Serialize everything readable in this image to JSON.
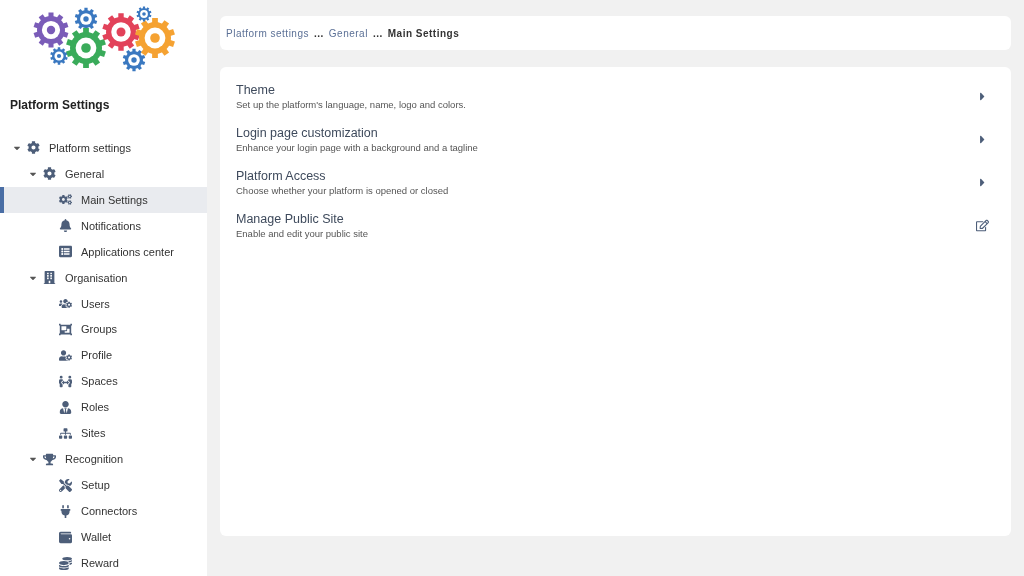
{
  "sidebar": {
    "title": "Platform Settings",
    "tree": [
      {
        "label": "Platform settings",
        "expanded": true,
        "selected": false,
        "children": [
          {
            "label": "General",
            "expanded": true,
            "selected": false,
            "children": [
              {
                "label": "Main Settings",
                "selected": true
              },
              {
                "label": "Notifications",
                "selected": false
              },
              {
                "label": "Applications center",
                "selected": false
              }
            ]
          },
          {
            "label": "Organisation",
            "expanded": true,
            "selected": false,
            "children": [
              {
                "label": "Users",
                "selected": false
              },
              {
                "label": "Groups",
                "selected": false
              },
              {
                "label": "Profile",
                "selected": false
              },
              {
                "label": "Spaces",
                "selected": false
              },
              {
                "label": "Roles",
                "selected": false
              },
              {
                "label": "Sites",
                "selected": false
              }
            ]
          },
          {
            "label": "Recognition",
            "expanded": true,
            "selected": false,
            "children": [
              {
                "label": "Setup",
                "selected": false
              },
              {
                "label": "Connectors",
                "selected": false
              },
              {
                "label": "Wallet",
                "selected": false
              },
              {
                "label": "Reward",
                "selected": false
              }
            ]
          }
        ]
      }
    ]
  },
  "breadcrumb": [
    {
      "label": "Platform settings",
      "current": false
    },
    {
      "label": "General",
      "current": false
    },
    {
      "label": "Main Settings",
      "current": true
    }
  ],
  "breadcrumb_separator": "...",
  "settings": [
    {
      "title": "Theme",
      "description": "Set up the platform's language, name, logo and colors.",
      "kind": "open"
    },
    {
      "title": "Login page customization",
      "description": "Enhance your login page with a background and a tagline",
      "kind": "open"
    },
    {
      "title": "Platform Access",
      "description": "Choose whether your platform is opened or closed",
      "kind": "open"
    },
    {
      "title": "Manage Public Site",
      "description": "Enable and edit your public site",
      "kind": "edit"
    }
  ]
}
